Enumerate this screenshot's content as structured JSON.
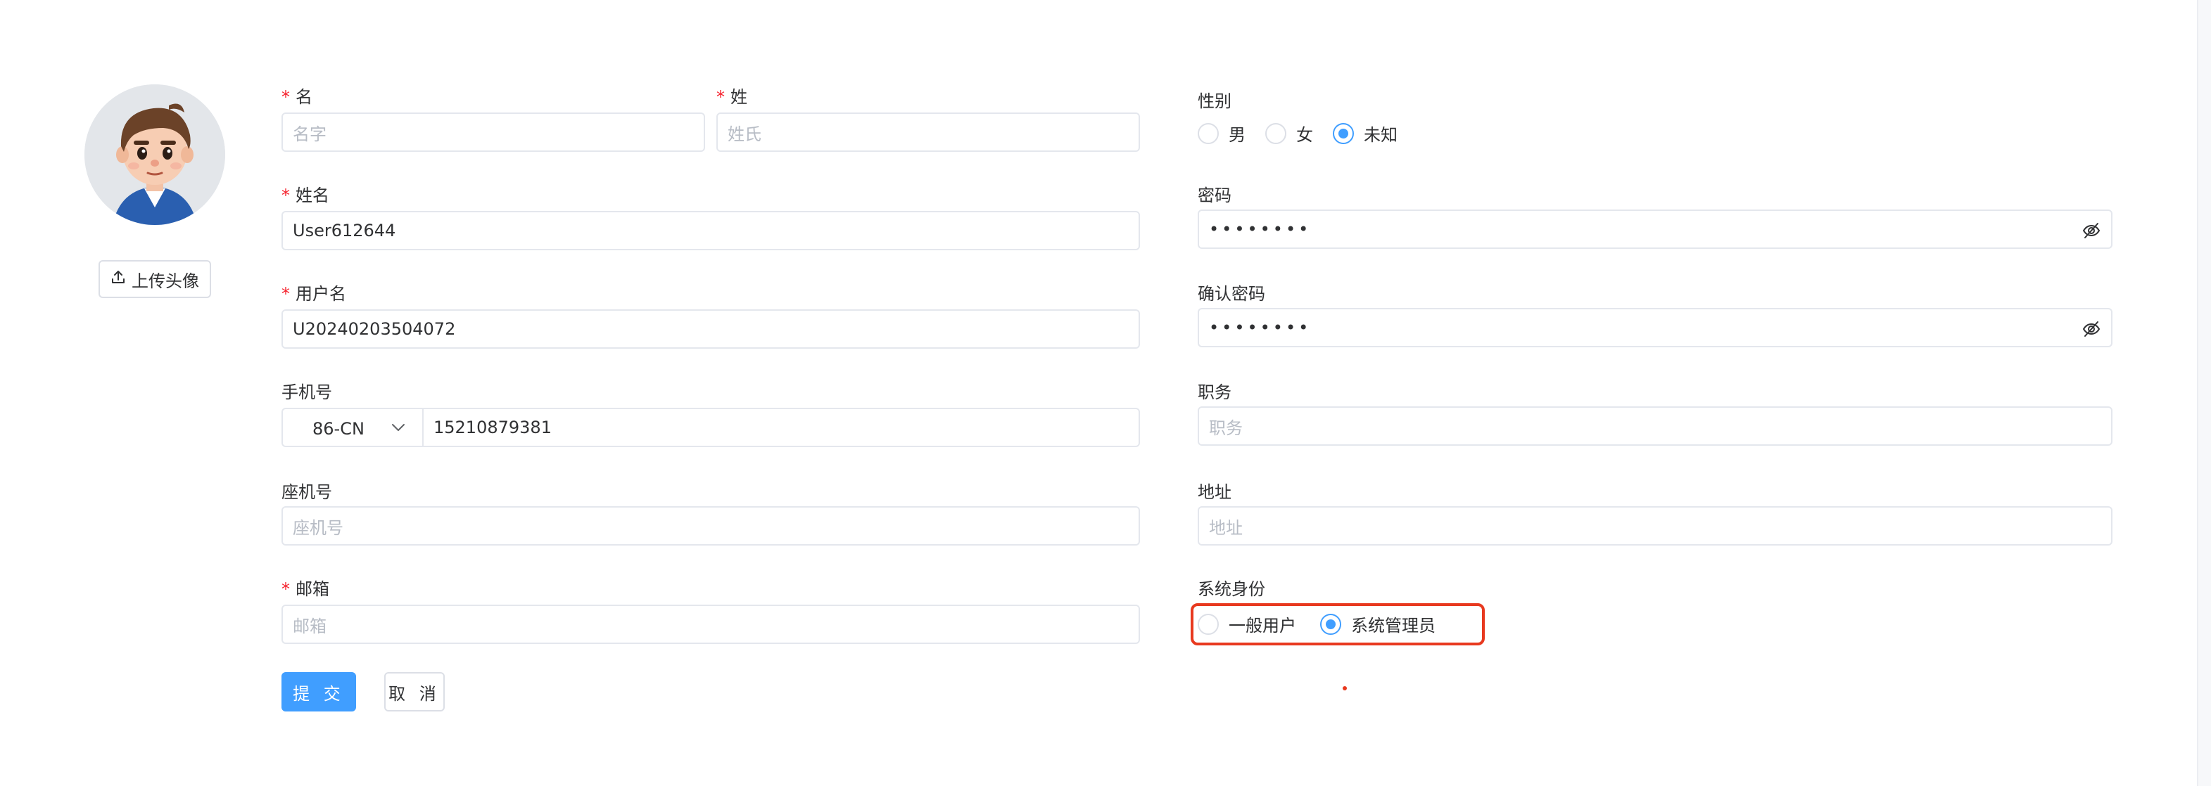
{
  "avatar": {
    "upload_label": "上传头像"
  },
  "form": {
    "first_name": {
      "label": "名",
      "placeholder": "名字",
      "value": ""
    },
    "last_name": {
      "label": "姓",
      "placeholder": "姓氏",
      "value": ""
    },
    "full_name": {
      "label": "姓名",
      "value": "User612644"
    },
    "username": {
      "label": "用户名",
      "value": "U20240203504072"
    },
    "mobile": {
      "label": "手机号",
      "country_code": "86-CN",
      "value": "15210879381"
    },
    "landline": {
      "label": "座机号",
      "placeholder": "座机号",
      "value": ""
    },
    "email": {
      "label": "邮箱",
      "placeholder": "邮箱",
      "value": ""
    },
    "gender": {
      "label": "性别",
      "options": [
        "男",
        "女",
        "未知"
      ],
      "selected": "未知"
    },
    "password": {
      "label": "密码",
      "value": "••••••••"
    },
    "confirm_password": {
      "label": "确认密码",
      "value": "••••••••"
    },
    "position": {
      "label": "职务",
      "placeholder": "职务",
      "value": ""
    },
    "address": {
      "label": "地址",
      "placeholder": "地址",
      "value": ""
    },
    "system_role": {
      "label": "系统身份",
      "options": [
        "一般用户",
        "系统管理员"
      ],
      "selected": "系统管理员"
    }
  },
  "actions": {
    "submit": "提 交",
    "cancel": "取 消"
  },
  "colors": {
    "primary": "#409eff",
    "required": "#f5222d",
    "highlight": "#e8391f"
  },
  "icons": [
    "upload-icon",
    "eye-off-icon",
    "chevron-down-icon"
  ]
}
